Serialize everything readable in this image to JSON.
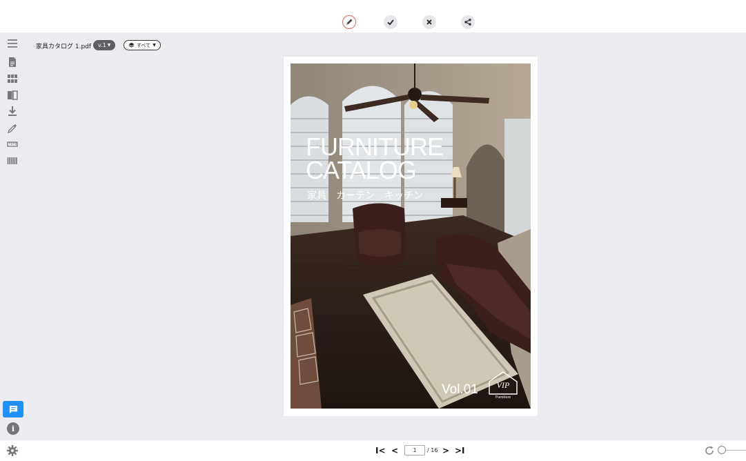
{
  "toolbar": {
    "icons": [
      "pencil-icon",
      "check-icon",
      "close-icon",
      "share-icon"
    ],
    "accent_color": "#e0605a"
  },
  "sidebar": {
    "icons": [
      "menu-icon",
      "document-icon",
      "grid-icon",
      "compare-icon",
      "download-icon",
      "eyedropper-icon",
      "ruler-icon",
      "barcode-icon"
    ]
  },
  "file": {
    "name": "家具カタログ 1.pdf",
    "version": "v.1",
    "layer": "すべて"
  },
  "cover": {
    "title_line1": "FURNITURE",
    "title_line2": "CATALOG",
    "subtitle": "家具　カーテン　キッチン",
    "volume": "Vol.01",
    "logo_text": "VIP",
    "logo_caption": "Furniture"
  },
  "pager": {
    "current": "1",
    "total": "/ 16",
    "first": "I<",
    "prev": "<",
    "next": ">",
    "last": ">I"
  },
  "colors": {
    "chat_button": "#1e90ff",
    "background": "#ececf0"
  }
}
